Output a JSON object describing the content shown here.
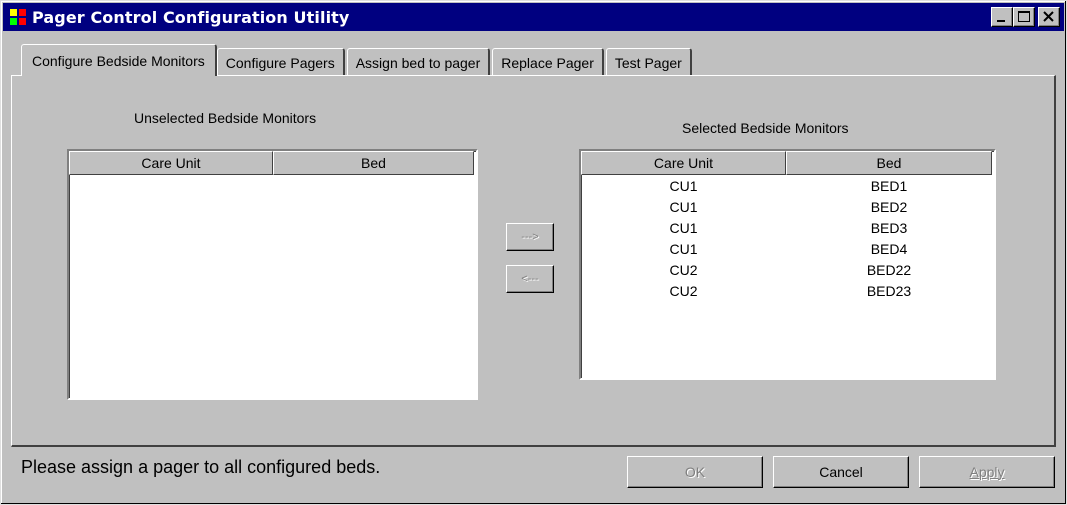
{
  "window": {
    "title": "Pager Control Configuration Utility"
  },
  "tabs": [
    {
      "label": "Configure Bedside Monitors",
      "active": true
    },
    {
      "label": "Configure Pagers",
      "active": false
    },
    {
      "label": "Assign bed to pager",
      "active": false
    },
    {
      "label": "Replace Pager",
      "active": false
    },
    {
      "label": "Test Pager",
      "active": false
    }
  ],
  "unselected": {
    "label": "Unselected Bedside Monitors",
    "columns": [
      "Care Unit",
      "Bed"
    ],
    "rows": []
  },
  "selected": {
    "label": "Selected Bedside Monitors",
    "columns": [
      "Care Unit",
      "Bed"
    ],
    "rows": [
      [
        "CU1",
        "BED1"
      ],
      [
        "CU1",
        "BED2"
      ],
      [
        "CU1",
        "BED3"
      ],
      [
        "CU1",
        "BED4"
      ],
      [
        "CU2",
        "BED22"
      ],
      [
        "CU2",
        "BED23"
      ]
    ]
  },
  "transfer": {
    "add_label": "--->",
    "remove_label": "<---"
  },
  "status": {
    "message": "Please assign a pager to all configured beds."
  },
  "buttons": {
    "ok": "OK",
    "cancel": "Cancel",
    "apply": "Apply"
  }
}
